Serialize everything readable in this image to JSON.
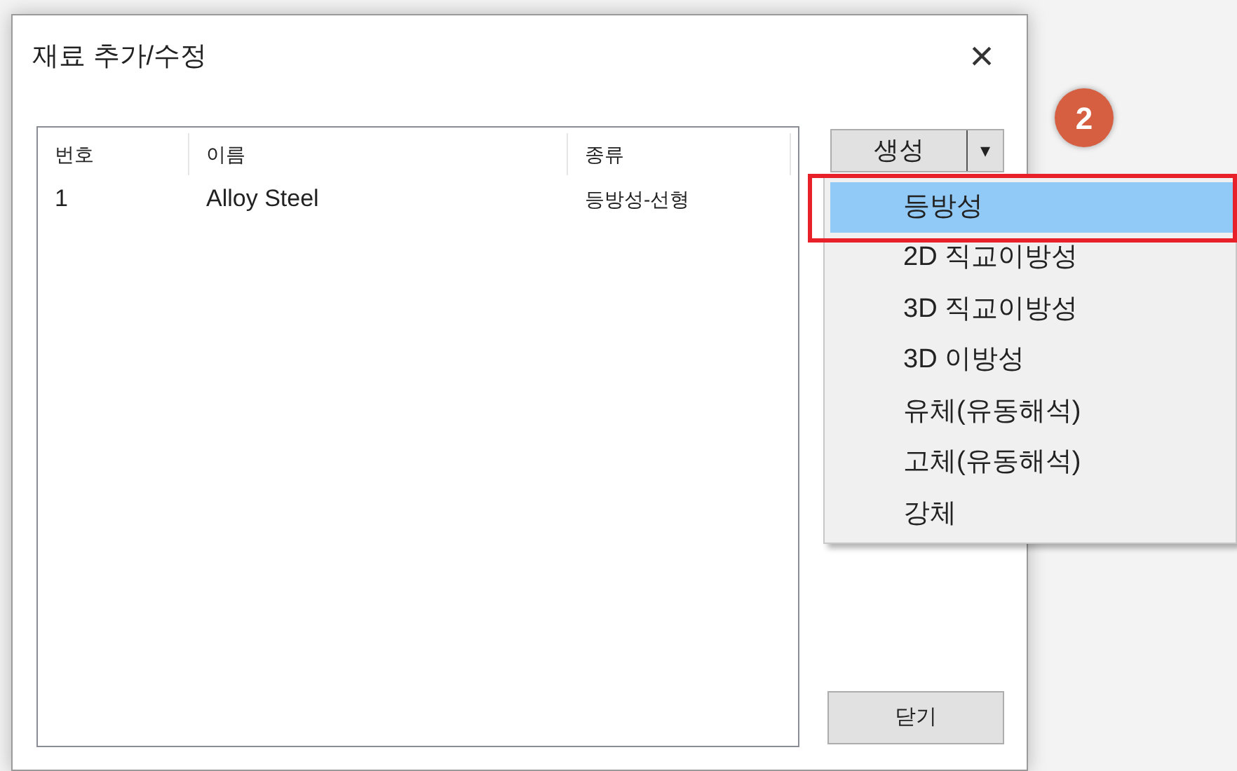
{
  "window": {
    "title": "재료 추가/수정",
    "close": "×"
  },
  "table": {
    "columns": [
      "번호",
      "이름",
      "종류"
    ],
    "rows": [
      [
        "1",
        "Alloy Steel",
        "등방성-선형"
      ]
    ]
  },
  "create_button": {
    "label": "생성",
    "arrow": "▾"
  },
  "dropdown": {
    "items": [
      {
        "label": "등방성",
        "selected": true
      },
      {
        "label": "2D 직교이방성",
        "selected": false
      },
      {
        "label": "3D 직교이방성",
        "selected": false
      },
      {
        "label": "3D 이방성",
        "selected": false
      },
      {
        "label": "유체(유동해석)",
        "selected": false
      },
      {
        "label": "고체(유동해석)",
        "selected": false
      },
      {
        "label": "강체",
        "selected": false
      }
    ]
  },
  "step_badge": "2",
  "close_button": "닫기"
}
